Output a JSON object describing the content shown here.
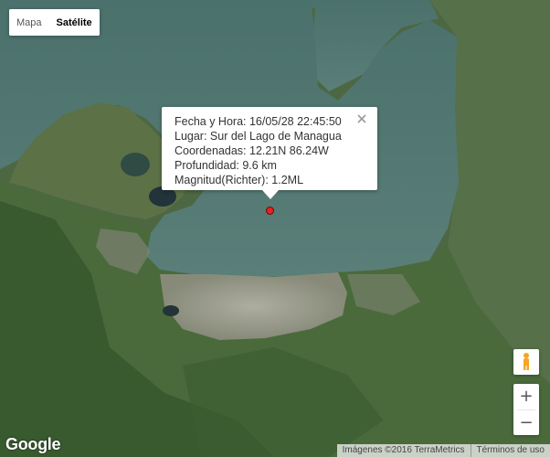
{
  "map_type": {
    "options": [
      {
        "label": "Mapa",
        "active": false
      },
      {
        "label": "Satélite",
        "active": true
      }
    ]
  },
  "info_window": {
    "datetime": "Fecha y Hora: 16/05/28 22:45:50",
    "place": "Lugar: Sur del Lago de Managua",
    "coordinates": "Coordenadas: 12.21N 86.24W",
    "depth": "Profundidad: 9.6 km",
    "magnitude": "Magnitud(Richter): 1.2ML",
    "close_icon": "close-icon"
  },
  "marker": {
    "color": "#e02424",
    "icon": "epicenter-marker"
  },
  "controls": {
    "pegman_icon": "pegman-icon",
    "zoom_in": "+",
    "zoom_out": "−"
  },
  "logo": "Google",
  "attribution": {
    "imagery": "Imágenes ©2016 TerraMetrics",
    "terms": "Términos de uso"
  },
  "colors": {
    "lake": "#4a6f6a",
    "land": "#4b6340",
    "urban": "#9c9a92"
  }
}
